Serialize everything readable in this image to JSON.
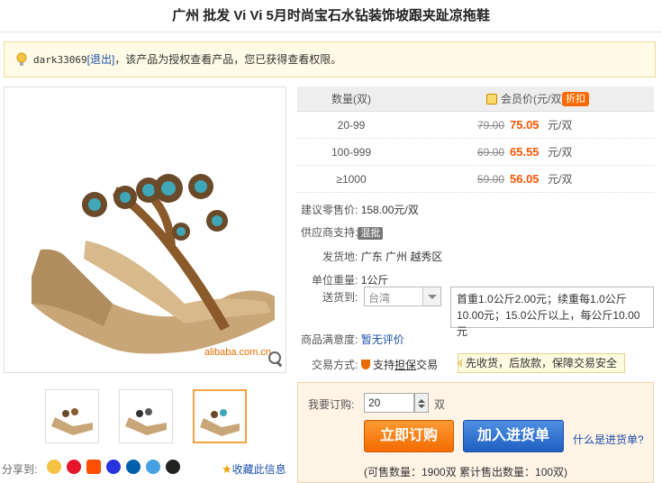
{
  "title": "广州  批发  Vi Vi 5月时尚宝石水钻装饰坡跟夹趾凉拖鞋",
  "notice": {
    "user": "dark33069",
    "logout": "[退出]",
    "text": "，该产品为授权查看产品，您已获得查看权限。"
  },
  "gallery": {
    "logo": "alibaba.com.cn"
  },
  "share": {
    "label": "分享到:",
    "icons": [
      "qzone-icon",
      "weibo-icon",
      "taobao-icon",
      "baidu-icon",
      "renren-icon",
      "qq-weibo-icon",
      "qq-icon"
    ]
  },
  "favorite": {
    "label": "收藏此信息"
  },
  "price_table": {
    "col_qty": "数量(双)",
    "col_price": "会员价(元/双)",
    "badge": "折扣",
    "rows": [
      {
        "qty": "20-99",
        "old": "79.00",
        "new": "75.05",
        "unit": "元/双"
      },
      {
        "qty": "100-999",
        "old": "69.00",
        "new": "65.55",
        "unit": "元/双"
      },
      {
        "qty": "≥1000",
        "old": "59.00",
        "new": "56.05",
        "unit": "元/双"
      }
    ]
  },
  "info": {
    "retail_label": "建议零售价:",
    "retail_value": "158.00元/双",
    "supplier_label": "供应商支持:",
    "supplier_tag": "混批",
    "ship_from_label": "发货地:",
    "ship_from_value": "广东 广州 越秀区",
    "weight_label": "单位重量:",
    "weight_value": "1公斤",
    "ship_to_label": "送货到:",
    "ship_to_value": "台湾",
    "ship_fee": "首重1.0公斤2.00元；续重每1.0公斤10.00元；15.0公斤以上，每公斤10.00元",
    "satisfaction_label": "商品满意度:",
    "satisfaction_value": "暂无评价",
    "trade_label": "交易方式:",
    "trade_value_pre": "支持",
    "trade_value_link": "担保",
    "trade_value_post": "交易",
    "tip": "先收货，后放款，保障交易安全"
  },
  "order": {
    "label": "我要订购:",
    "qty": "20",
    "unit": "双",
    "buy": "立即订购",
    "cart": "加入进货单",
    "what": "什么是进货单?",
    "stats": "(可售数量：1900双  累计售出数量：100双)"
  }
}
